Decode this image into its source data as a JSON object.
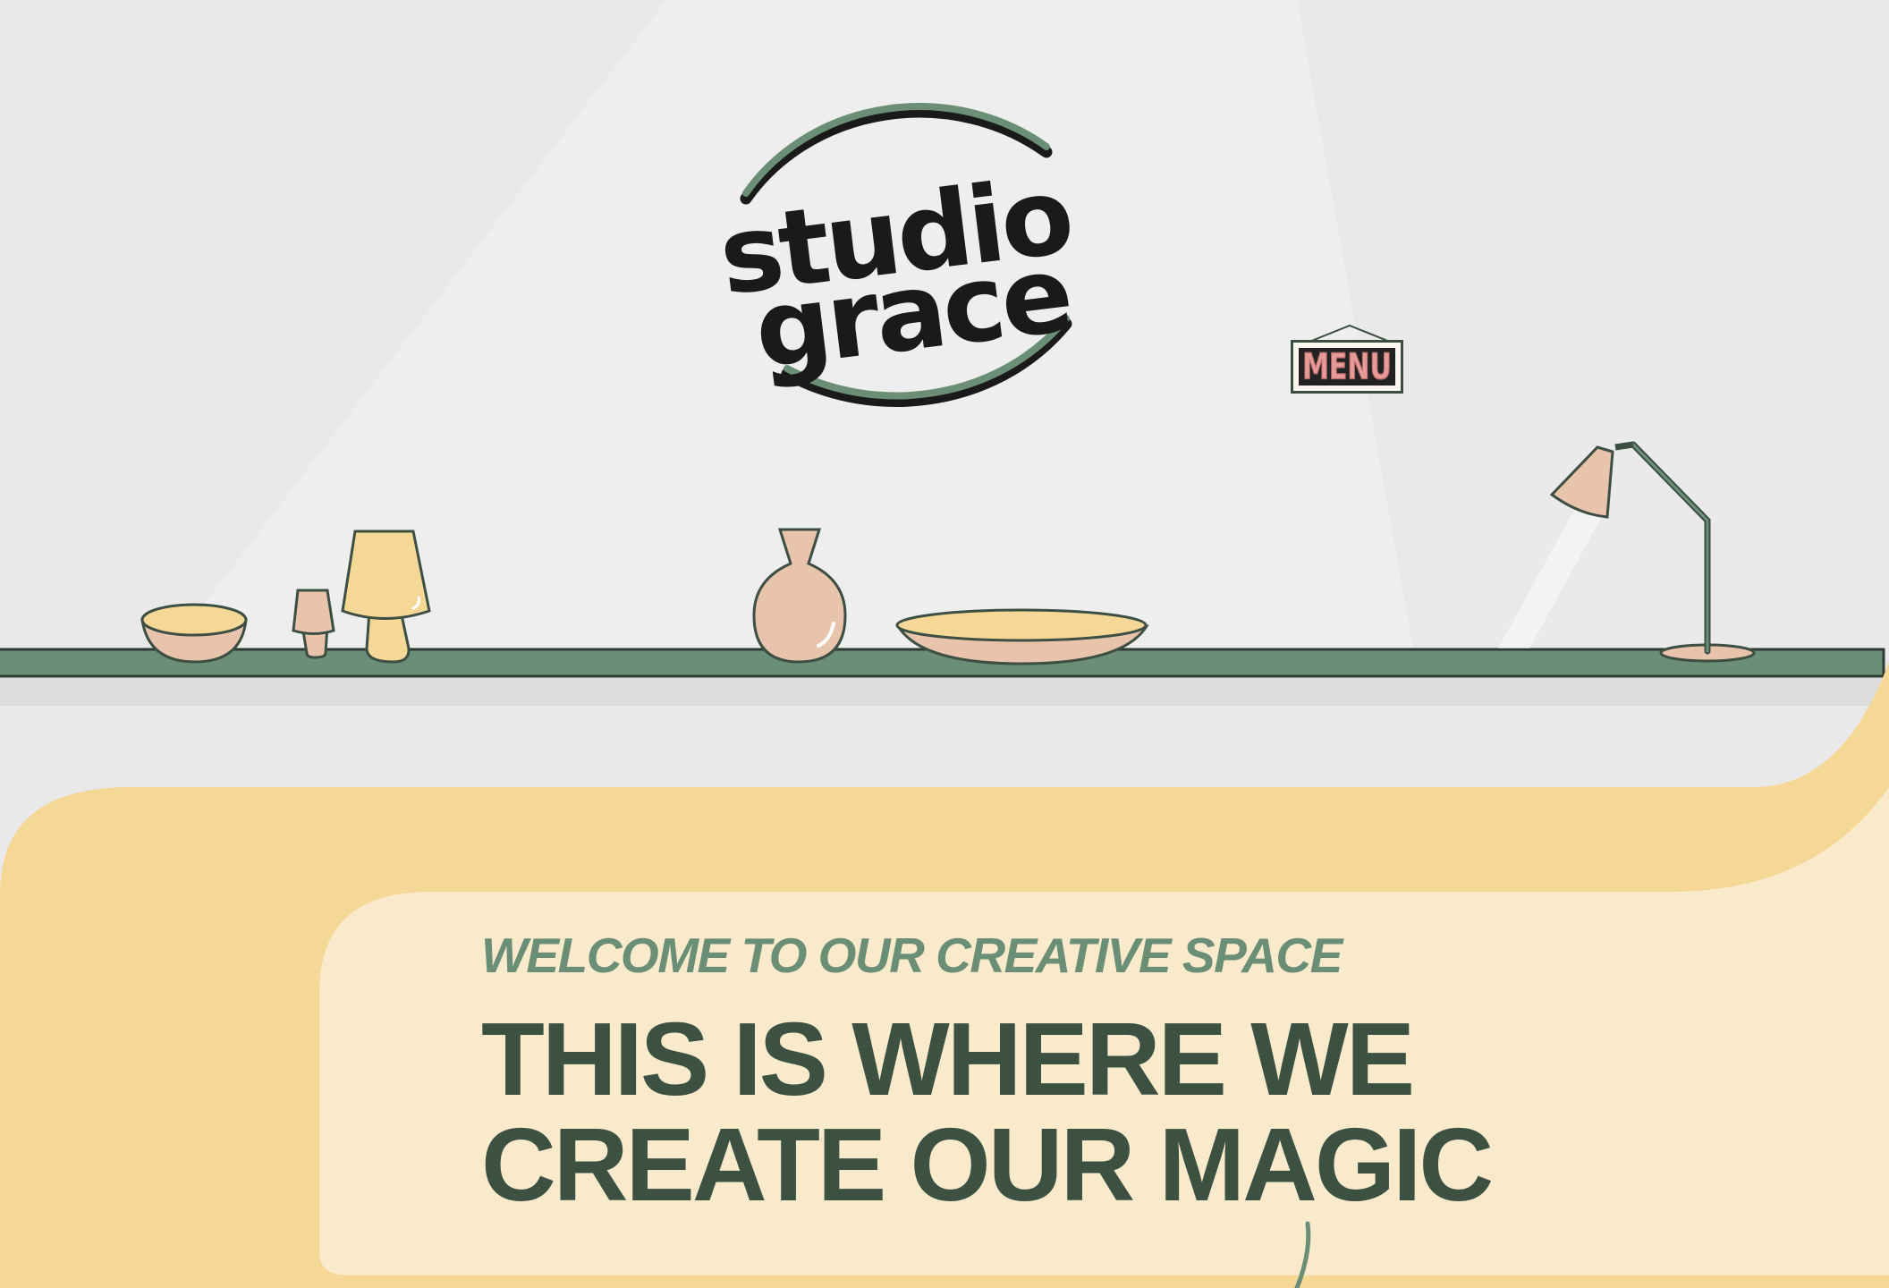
{
  "brand": {
    "logo_line1": "studio",
    "logo_line2": "grace"
  },
  "nav": {
    "menu_label": "MENU"
  },
  "hero": {
    "eyebrow": "WELCOME TO OUR CREATIVE SPACE",
    "headline_line1": "THIS IS WHERE WE",
    "headline_line2": "CREATE OUR MAGIC"
  },
  "colors": {
    "background": "#e9e9e9",
    "shelf_green": "#6a8e76",
    "dark_green": "#3c5142",
    "peach": "#e9c4ad",
    "yellow": "#f5d796",
    "cream": "#f9eacb",
    "ink": "#1a1a1a"
  }
}
